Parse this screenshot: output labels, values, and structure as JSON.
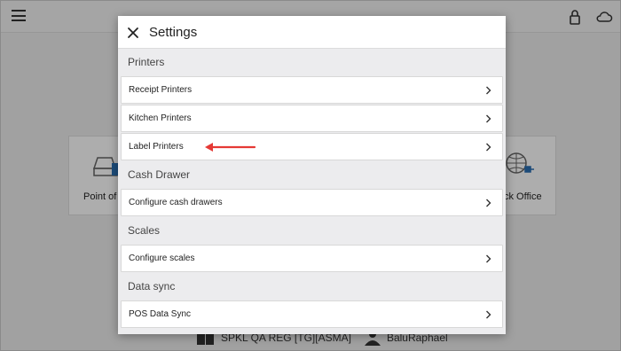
{
  "background": {
    "card_left_label": "Point of S",
    "card_right_label": "ck Office",
    "footer_store": "SPKL QA REG [TG][ASMA]",
    "footer_user": "BaluRaphael"
  },
  "modal": {
    "title": "Settings",
    "sections": [
      {
        "title": "Printers",
        "items": [
          "Receipt Printers",
          "Kitchen Printers",
          "Label Printers"
        ]
      },
      {
        "title": "Cash Drawer",
        "items": [
          "Configure cash drawers"
        ]
      },
      {
        "title": "Scales",
        "items": [
          "Configure scales"
        ]
      },
      {
        "title": "Data sync",
        "items": [
          "POS Data Sync"
        ]
      }
    ]
  },
  "colors": {
    "annotation_arrow": "#e53935",
    "overlay": "rgba(0,0,0,0.32)"
  },
  "icons": [
    "menu-icon",
    "lock-icon",
    "cloud-icon",
    "close-icon",
    "chevron-right-icon"
  ]
}
